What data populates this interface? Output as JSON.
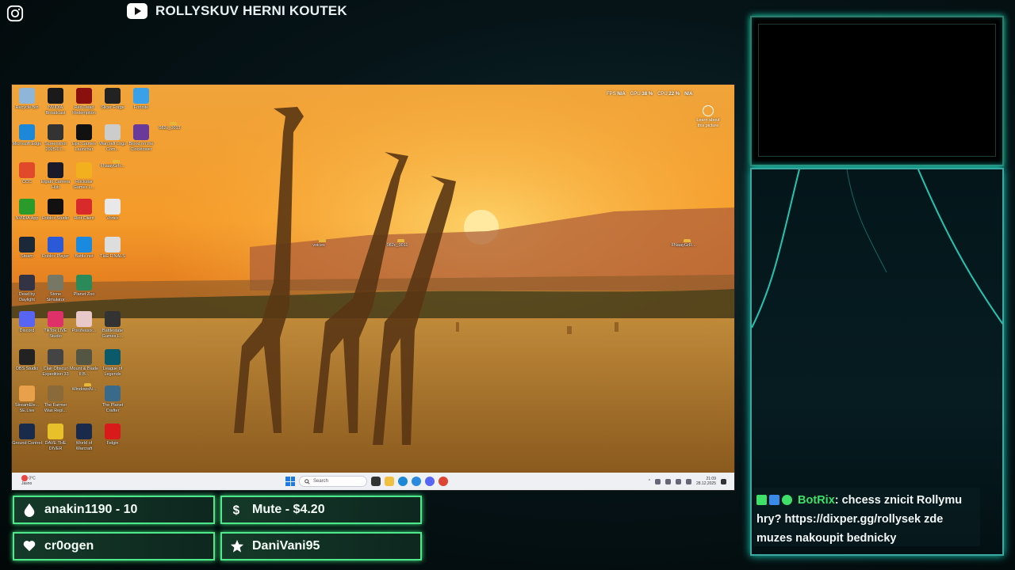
{
  "overlay": {
    "channel_name": "ROLLYSKUV HERNI KOUTEK",
    "icons": [
      "instagram-icon",
      "youtube-icon"
    ]
  },
  "desktop": {
    "perf": {
      "fps_label": "FPS",
      "fps_value": "N/A",
      "gpu_label": "GPU",
      "gpu_value": "38 %",
      "cpu_label": "CPU",
      "cpu_value": "22 %",
      "extra_value": "N/A"
    },
    "learn_label": "Learn about this picture",
    "icons": [
      {
        "label": "Recycle Bin",
        "color": "#8fb6d8"
      },
      {
        "label": "NVIDIA Broadcast",
        "color": "#1a1a1a"
      },
      {
        "label": "Red Dead Redemption",
        "color": "#8a1010"
      },
      {
        "label": "Slicer Forge",
        "color": "#222222"
      },
      {
        "label": "Fortnite",
        "color": "#3aa0e8"
      },
      {
        "label": "Microsoft Edge",
        "color": "#1e88d8"
      },
      {
        "label": "Screenshot 2025-07...",
        "color": "#333333"
      },
      {
        "label": "Epic Games Launcher",
        "color": "#111111"
      },
      {
        "label": "Warcraft Logs Com...",
        "color": "#cccccc"
      },
      {
        "label": "Blood on the Clocktower",
        "color": "#6a3a9a"
      },
      {
        "label": "082c_0013",
        "color": "folder"
      },
      {
        "label": "CCC",
        "color": "#e04a2a"
      },
      {
        "label": "Elgato Camera Hub",
        "color": "#1a1a2a"
      },
      {
        "label": "Rockstar Games L...",
        "color": "#f2b01e"
      },
      {
        "label": "FNaayGrR...",
        "color": "folder"
      },
      {
        "label": "NVIDIA App",
        "color": "#2a9a2a"
      },
      {
        "label": "Roblox Studio",
        "color": "#111111"
      },
      {
        "label": "Riot Client",
        "color": "#d82a2a"
      },
      {
        "label": "Vortex",
        "color": "#e8e8e8"
      },
      {
        "label": "Steam",
        "color": "#1b2838"
      },
      {
        "label": "Roblox Player",
        "color": "#2a5ad8"
      },
      {
        "label": "Battle.net",
        "color": "#1a8ae0"
      },
      {
        "label": "THE FINALS",
        "color": "#dddddd"
      },
      {
        "label": "Dead by Daylight",
        "color": "#333344"
      },
      {
        "label": "Stone Simulator",
        "color": "#777766"
      },
      {
        "label": "Planet Zoo",
        "color": "#2a8a5a"
      },
      {
        "label": "Discord",
        "color": "#5865f2"
      },
      {
        "label": "TikTok LIVE Studio",
        "color": "#e0306a"
      },
      {
        "label": "Porofessor...",
        "color": "#e8c8c8"
      },
      {
        "label": "Battlestate Games L...",
        "color": "#333333"
      },
      {
        "label": "OBS Studio",
        "color": "#222222"
      },
      {
        "label": "Clair Obscur Expedition 33",
        "color": "#444444"
      },
      {
        "label": "Mount & Blade II B...",
        "color": "#555544"
      },
      {
        "label": "League of Legends",
        "color": "#0a5a6a"
      },
      {
        "label": "StreamEle... SE.Live",
        "color": "#e8a04a"
      },
      {
        "label": "The Farmer Was Repl...",
        "color": "#8a6a3a"
      },
      {
        "label": "WindowsN...",
        "color": "folder"
      },
      {
        "label": "The Planet Crafter",
        "color": "#3a6a8a"
      },
      {
        "label": "Ground Control",
        "color": "#1a2a4a"
      },
      {
        "label": "DAVE THE DIVER",
        "color": "#e8c02a"
      },
      {
        "label": "World of Warcraft",
        "color": "#1a2a4a"
      },
      {
        "label": "Felgin",
        "color": "#d81a1a"
      }
    ],
    "free_folders": [
      {
        "label": "voices"
      },
      {
        "label": "082c_0011"
      },
      {
        "label": "FNaayGrR..."
      }
    ],
    "taskbar": {
      "weather_temp": "0°C",
      "weather_desc": "Jasno",
      "search_placeholder": "Search",
      "time": "21:09",
      "date": "28.12.2025"
    }
  },
  "stats": {
    "top_left": "anakin1190 - 10",
    "top_right": "Mute - $4.20",
    "bottom_left": "cr0ogen",
    "bottom_right": "DaniVani95"
  },
  "chat": {
    "user": "BotRix",
    "message": ": chcess znicit Rollymu hry? https://dixper.gg/rollysek zde muzes nakoupit bednicky"
  },
  "colors": {
    "accent_green": "#4fe88a",
    "chat_user": "#3fe06a",
    "frame_teal": "#1bd6c0"
  }
}
